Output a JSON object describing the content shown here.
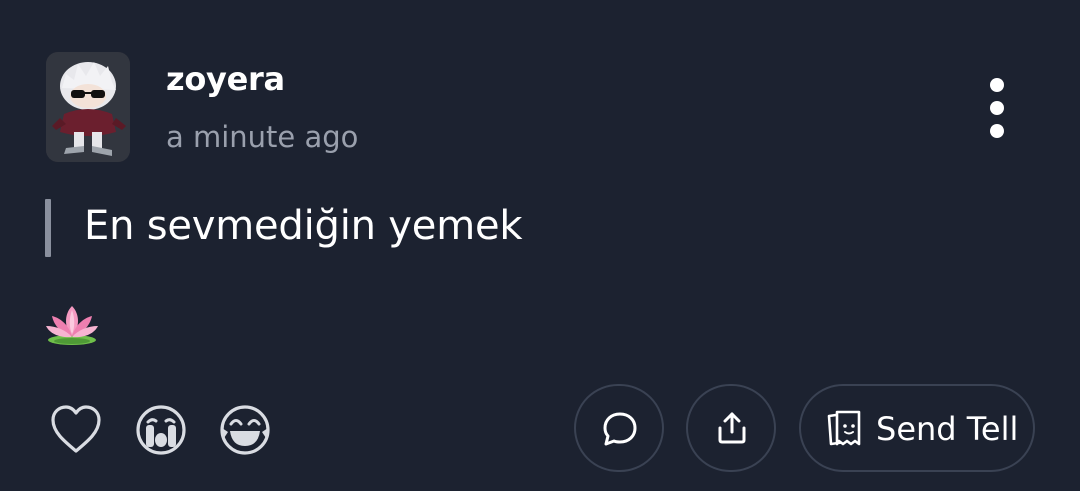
{
  "post": {
    "username": "zoyera",
    "timestamp": "a minute ago",
    "question": "En sevmediğin yemek",
    "answer_emoji_name": "lotus-emoji"
  },
  "reactions": [
    {
      "name": "heart-icon"
    },
    {
      "name": "crying-face-icon"
    },
    {
      "name": "laughing-face-icon"
    }
  ],
  "actions": {
    "comment_icon": "chat-bubble-icon",
    "share_icon": "share-upload-icon",
    "send_tell_label": "Send Tell",
    "send_tell_icon": "ghost-note-icon"
  },
  "colors": {
    "background": "#1c2230",
    "text_primary": "#ffffff",
    "text_secondary": "#9aa0ad",
    "pill_border": "#3a4253",
    "quote_bar": "#8a909e",
    "icon_gray": "#d9dce2"
  }
}
